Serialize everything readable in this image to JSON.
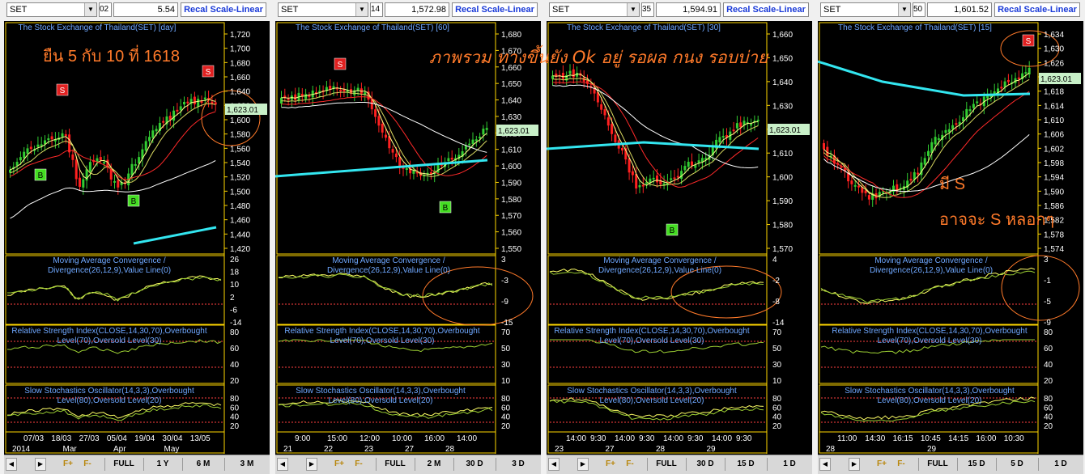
{
  "panels": [
    {
      "symbol": "SET",
      "period": "02",
      "last_price": "5.54",
      "scale_button": "Recal Scale-Linear",
      "main_title": "The Stock Exchange of Thailand(SET) [day]",
      "macd_title_1": "Moving Average Convergence /",
      "macd_title_2": "Divergence(26,12,9),Value Line(0)",
      "rsi_title_1": "Relative Strength Index(CLOSE,14,30,70),Overbought",
      "rsi_title_2": "Level(70),Oversold Level(30)",
      "stoch_title_1": "Slow Stochastics Oscillator(14,3,3),Overbought",
      "stoch_title_2": "Level(80),Oversold Level(20)",
      "price_ticks": [
        "1,720",
        "1,700",
        "1,680",
        "1,660",
        "1,640",
        "1,620",
        "1,600",
        "1,580",
        "1,560",
        "1,540",
        "1,520",
        "1,500",
        "1,480",
        "1,460",
        "1,440",
        "1,420"
      ],
      "price_label": "1,623.01",
      "macd_ticks": [
        "26",
        "18",
        "10",
        "2",
        "-6",
        "-14"
      ],
      "rsi_ticks": [
        "80",
        "60",
        "40",
        "20"
      ],
      "stoch_ticks": [
        "80",
        "60",
        "40",
        "20"
      ],
      "date_row1": [
        "07/03",
        "18/03",
        "27/03",
        "05/04",
        "19/04",
        "30/04",
        "13/05"
      ],
      "date_row2": [
        "2014",
        "Mar",
        "Apr",
        "May"
      ],
      "signals": [
        "S",
        "S",
        "B",
        "B"
      ],
      "annotation": "ยืน 5 กับ 10 ที่ 1618",
      "bottom": [
        "F+",
        "F-",
        "FULL",
        "1 Y",
        "6 M",
        "3 M"
      ]
    },
    {
      "symbol": "SET",
      "period": "14",
      "last_price": "1,572.98",
      "scale_button": "Recal Scale-Linear",
      "main_title": "The Stock Exchange of Thailand(SET) [60]",
      "macd_title_1": "Moving Average Convergence /",
      "macd_title_2": "Divergence(26,12,9),Value Line(0)",
      "rsi_title_1": "Relative Strength Index(CLOSE,14,30,70),Overbought",
      "rsi_title_2": "Level(70),Oversold Level(30)",
      "stoch_title_1": "Slow Stochastics Oscillator(14,3,3),Overbought",
      "stoch_title_2": "Level(80),Oversold Level(20)",
      "price_ticks": [
        "1,680",
        "1,670",
        "1,660",
        "1,650",
        "1,640",
        "1,630",
        "1,620",
        "1,610",
        "1,600",
        "1,590",
        "1,580",
        "1,570",
        "1,560",
        "1,550"
      ],
      "price_label": "1,623.01",
      "macd_ticks": [
        "3",
        "-3",
        "-9",
        "-15"
      ],
      "rsi_ticks": [
        "70",
        "50",
        "30",
        "10"
      ],
      "stoch_ticks": [
        "80",
        "60",
        "40",
        "20"
      ],
      "date_row1": [
        "9:00",
        "15:00",
        "12:00",
        "10:00",
        "16:00",
        "14:00"
      ],
      "date_row2": [
        "21",
        "22",
        "23",
        "27",
        "28"
      ],
      "signals": [
        "S",
        "B"
      ],
      "annotation": "ภาพรวม ทางขึ้นยัง Ok อยู่ รอผล กนง รอบบ่าย",
      "bottom": [
        "F+",
        "F-",
        "FULL",
        "2 M",
        "30 D",
        "3 D"
      ]
    },
    {
      "symbol": "SET",
      "period": "35",
      "last_price": "1,594.91",
      "scale_button": "Recal Scale-Linear",
      "main_title": "The Stock Exchange of Thailand(SET) [30]",
      "macd_title_1": "Moving Average Convergence /",
      "macd_title_2": "Divergence(26,12,9),Value Line(0)",
      "rsi_title_1": "Relative Strength Index(CLOSE,14,30,70),Overbought",
      "rsi_title_2": "Level(70),Oversold Level(30)",
      "stoch_title_1": "Slow Stochastics Oscillator(14,3,3),Overbought",
      "stoch_title_2": "Level(80),Oversold Level(20)",
      "price_ticks": [
        "1,660",
        "1,650",
        "1,640",
        "1,630",
        "1,620",
        "1,610",
        "1,600",
        "1,590",
        "1,580",
        "1,570"
      ],
      "price_label": "1,623.01",
      "macd_ticks": [
        "4",
        "-2",
        "-8",
        "-14"
      ],
      "rsi_ticks": [
        "70",
        "50",
        "30",
        "10"
      ],
      "stoch_ticks": [
        "80",
        "60",
        "40",
        "20"
      ],
      "date_row1": [
        "14:00",
        "9:30",
        "14:00",
        "9:30",
        "14:00",
        "9:30",
        "14:00",
        "9:30"
      ],
      "date_row2": [
        "23",
        "27",
        "28",
        "29"
      ],
      "signals": [
        "B"
      ],
      "bottom": [
        "F+",
        "F-",
        "FULL",
        "30 D",
        "15 D",
        "1 D"
      ]
    },
    {
      "symbol": "SET",
      "period": "50",
      "last_price": "1,601.52",
      "scale_button": "Recal Scale-Linear",
      "main_title": "The Stock Exchange of Thailand(SET) [15]",
      "macd_title_1": "Moving Average Convergence /",
      "macd_title_2": "Divergence(26,12,9),Value Line(0)",
      "rsi_title_1": "Relative Strength Index(CLOSE,14,30,70),Overbought",
      "rsi_title_2": "Level(70),Oversold Level(30)",
      "stoch_title_1": "Slow Stochastics Oscillator(14,3,3),Overbought",
      "stoch_title_2": "Level(80),Oversold Level(20)",
      "price_ticks": [
        "1,634",
        "1,630",
        "1,626",
        "1,622",
        "1,618",
        "1,614",
        "1,610",
        "1,606",
        "1,602",
        "1,598",
        "1,594",
        "1,590",
        "1,586",
        "1,582",
        "1,578",
        "1,574"
      ],
      "price_label": "1,623.01",
      "macd_ticks": [
        "3",
        "-1",
        "-5",
        "-9"
      ],
      "rsi_ticks": [
        "80",
        "60",
        "40",
        "20"
      ],
      "stoch_ticks": [
        "80",
        "60",
        "40",
        "20"
      ],
      "date_row1": [
        "11:00",
        "14:30",
        "16:15",
        "10:45",
        "14:15",
        "16:00",
        "10:30"
      ],
      "date_row2": [
        "28",
        "29"
      ],
      "signals": [
        "S"
      ],
      "annotation_1": "มี S",
      "annotation_2": "อาจจะ S หลอกๆ",
      "bottom": [
        "F+",
        "F-",
        "FULL",
        "15 D",
        "5 D",
        "1 D"
      ]
    }
  ],
  "colors": {
    "axis": "#ffd700",
    "title": "#6fa8ff",
    "candle_up": "#32cd32",
    "candle_down": "#ff2020",
    "ma_fast": "#ffff88",
    "ma_mid": "#ff2a2a",
    "ma_slow": "#ffffff",
    "ma_long": "#33e6f0",
    "annotation": "#ff7a2a",
    "price_label_bg": "#c8f0c8"
  }
}
